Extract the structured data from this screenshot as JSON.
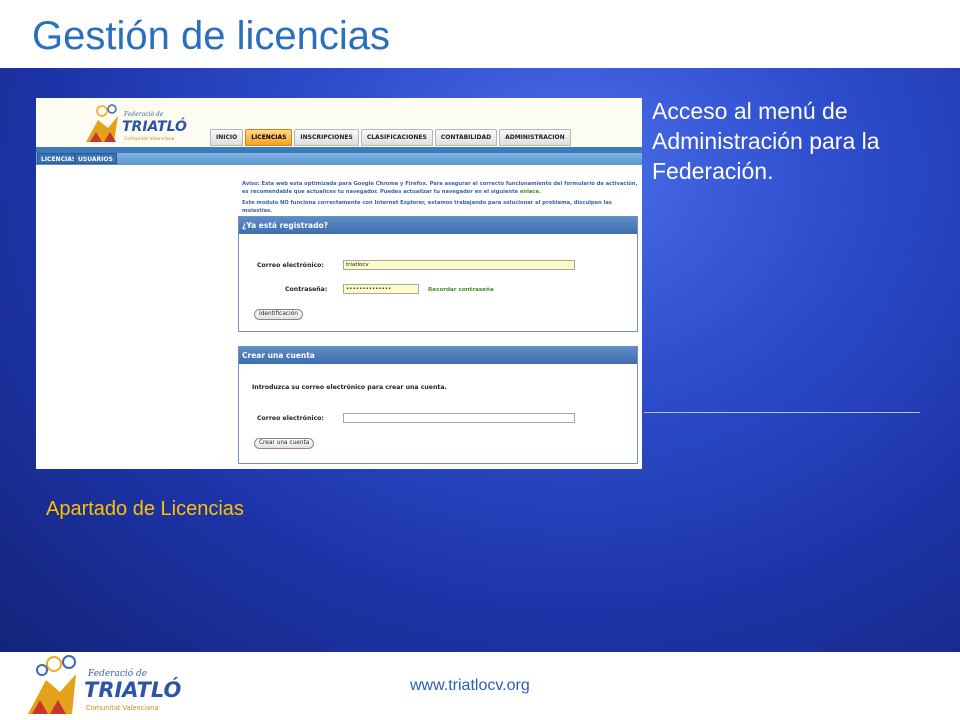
{
  "slide": {
    "title": "Gestión de licencias",
    "side_text": "Acceso al menú de Administración para la Federación.",
    "caption": "Apartado de Licencias",
    "footer_url": "www.triatlocv.org",
    "accent_color": "#ffc000",
    "background_color": "#2f4fcf"
  },
  "logo": {
    "line1": "Federació de",
    "line2": "TRIATLÓ",
    "line3": "Comunitat Valenciana"
  },
  "screenshot": {
    "nav_tabs": [
      {
        "label": "INICIO",
        "active": false
      },
      {
        "label": "LICENCIAS",
        "active": true
      },
      {
        "label": "INSCRIPCIONES",
        "active": false
      },
      {
        "label": "CLASIFICACIONES",
        "active": false
      },
      {
        "label": "CONTABILIDAD",
        "active": false
      },
      {
        "label": "ADMINISTRACION",
        "active": false
      }
    ],
    "sub_tabs": [
      "LICENCIAS",
      "USUARIOS"
    ],
    "notice": {
      "line1": "Aviso: Esta web esta optimizada para Google Chrome y Firefox. Para asegurar el correcto funcionamiento del formulario de activación, es recomendable que actualices tu navegador. Puedes actualizar tu navegador en el siguiente",
      "link": "enlace.",
      "line2": "Este modulo NO funciona correctamente con Internet Explorer, estamos trabajando para solucionar el problema, disculpen las molestias."
    },
    "login_panel": {
      "title": "¿Ya está registrado?",
      "email_label": "Correo electrónico:",
      "email_value": "triatlocv",
      "password_label": "Contraseña:",
      "password_value": "••••••••••••••",
      "remember_link": "Recordar contraseña",
      "submit_label": "Identificación"
    },
    "create_panel": {
      "title": "Crear una cuenta",
      "intro": "Introduzca su correo electrónico para crear una cuenta.",
      "email_label": "Correo electrónico:",
      "email_value": "",
      "submit_label": "Crear una cuenta"
    }
  }
}
